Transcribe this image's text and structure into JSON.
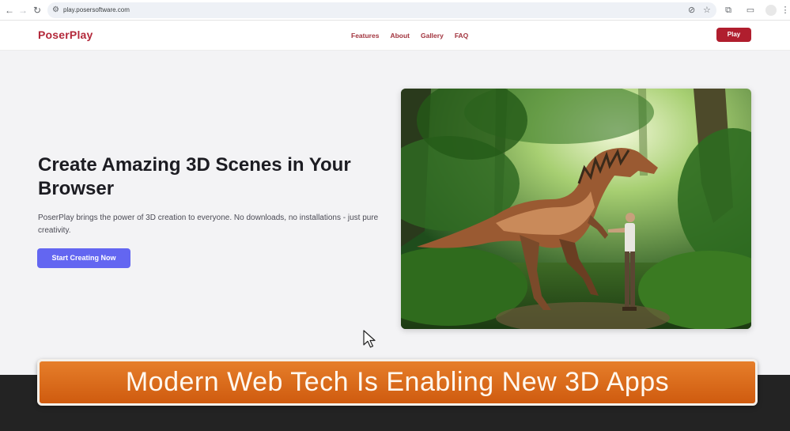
{
  "browser": {
    "url": "play.posersoftware.com",
    "back_icon": "←",
    "forward_icon": "→",
    "reload_icon": "↻",
    "site_info_icon": "⚙",
    "eye_off_icon": "⊘",
    "star_icon": "☆",
    "extensions_icon": "⧉",
    "cast_icon": "▭",
    "menu_icon": "⋮"
  },
  "site": {
    "logo": "PoserPlay",
    "nav": [
      "Features",
      "About",
      "Gallery",
      "FAQ"
    ],
    "play_button": "Play"
  },
  "hero": {
    "title": "Create Amazing 3D Scenes in Your Browser",
    "description": "PoserPlay brings the power of 3D creation to everyone. No downloads, no installations - just pure creativity.",
    "cta": "Start Creating Now"
  },
  "banner": {
    "text": "Modern Web Tech Is Enabling New 3D Apps"
  },
  "colors": {
    "brand": "#b3283a",
    "cta": "#6366f1",
    "banner": "#e0701e"
  }
}
